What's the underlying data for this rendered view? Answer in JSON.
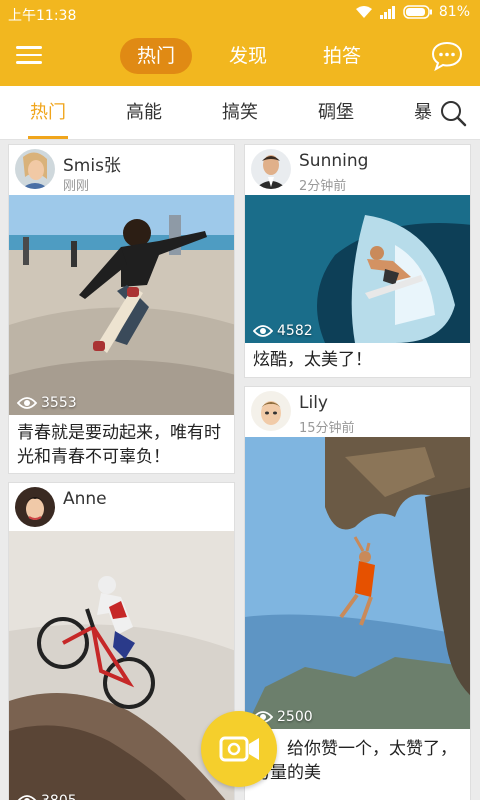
{
  "status": {
    "time": "上午11:38",
    "battery": "81%"
  },
  "header": {
    "tabs": [
      {
        "label": "热门",
        "active": true
      },
      {
        "label": "发现",
        "active": false
      },
      {
        "label": "拍答",
        "active": false
      }
    ]
  },
  "categories": [
    {
      "label": "热门",
      "active": true
    },
    {
      "label": "高能"
    },
    {
      "label": "搞笑"
    },
    {
      "label": "碉堡"
    },
    {
      "label": "暴"
    }
  ],
  "feed": [
    {
      "user": "Smis张",
      "time": "刚刚",
      "views": "3553",
      "caption": "青春就是要动起来，唯有时光和青春不可辜负！"
    },
    {
      "user": "Sunning",
      "time": "2分钟前",
      "views": "4582",
      "caption": "炫酷，太美了！"
    },
    {
      "user": "Lily",
      "time": "15分钟前",
      "views": "2500",
      "caption": "哥，给你赞一个，太赞了，力量的美"
    },
    {
      "user": "Anne",
      "views": "3805"
    }
  ],
  "colors": {
    "brand": "#f2b71f",
    "accent": "#f0a51c",
    "record": "#f5cf2c"
  }
}
